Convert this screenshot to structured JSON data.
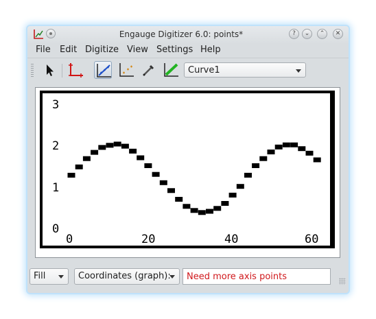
{
  "window": {
    "title": "Engauge Digitizer 6.0: points*"
  },
  "titlebar_buttons": [
    {
      "name": "help-button",
      "glyph": "?"
    },
    {
      "name": "minimize-button",
      "glyph": "⌄"
    },
    {
      "name": "maximize-button",
      "glyph": "⌃"
    },
    {
      "name": "close-button",
      "glyph": "✕"
    }
  ],
  "menu": [
    "File",
    "Edit",
    "Digitize",
    "View",
    "Settings",
    "Help"
  ],
  "toolbar": {
    "tools": [
      {
        "name": "select-tool-icon",
        "active": false
      },
      {
        "name": "axis-point-tool-icon",
        "active": false
      },
      {
        "name": "curve-point-tool-icon",
        "active": true
      },
      {
        "name": "point-match-tool-icon",
        "active": false
      },
      {
        "name": "color-picker-tool-icon",
        "active": false
      },
      {
        "name": "segment-fill-tool-icon",
        "active": false
      }
    ],
    "curve_selector": "Curve1"
  },
  "plot_image": {
    "x_ticks": [
      "0",
      "20",
      "40",
      "60"
    ],
    "y_ticks": [
      "0",
      "1",
      "2",
      "3"
    ],
    "points": [
      [
        0,
        1.2
      ],
      [
        2,
        1.4
      ],
      [
        4,
        1.6
      ],
      [
        6,
        1.75
      ],
      [
        8,
        1.87
      ],
      [
        10,
        1.92
      ],
      [
        12,
        1.95
      ],
      [
        14,
        1.9
      ],
      [
        16,
        1.78
      ],
      [
        18,
        1.62
      ],
      [
        20,
        1.43
      ],
      [
        22,
        1.22
      ],
      [
        24,
        1.02
      ],
      [
        26,
        0.83
      ],
      [
        28,
        0.62
      ],
      [
        30,
        0.45
      ],
      [
        32,
        0.35
      ],
      [
        34,
        0.3
      ],
      [
        36,
        0.33
      ],
      [
        38,
        0.4
      ],
      [
        40,
        0.52
      ],
      [
        42,
        0.72
      ],
      [
        44,
        0.93
      ],
      [
        46,
        1.2
      ],
      [
        48,
        1.43
      ],
      [
        50,
        1.6
      ],
      [
        52,
        1.76
      ],
      [
        54,
        1.88
      ],
      [
        56,
        1.93
      ],
      [
        58,
        1.93
      ],
      [
        60,
        1.84
      ],
      [
        62,
        1.73
      ],
      [
        64,
        1.57
      ]
    ]
  },
  "status": {
    "fill_mode": "Fill",
    "coords_mode": "Coordinates (graph):",
    "message": "Need more axis points"
  },
  "colors": {
    "accent_glow": "#bfe2fb",
    "status_error": "#d0181c"
  }
}
